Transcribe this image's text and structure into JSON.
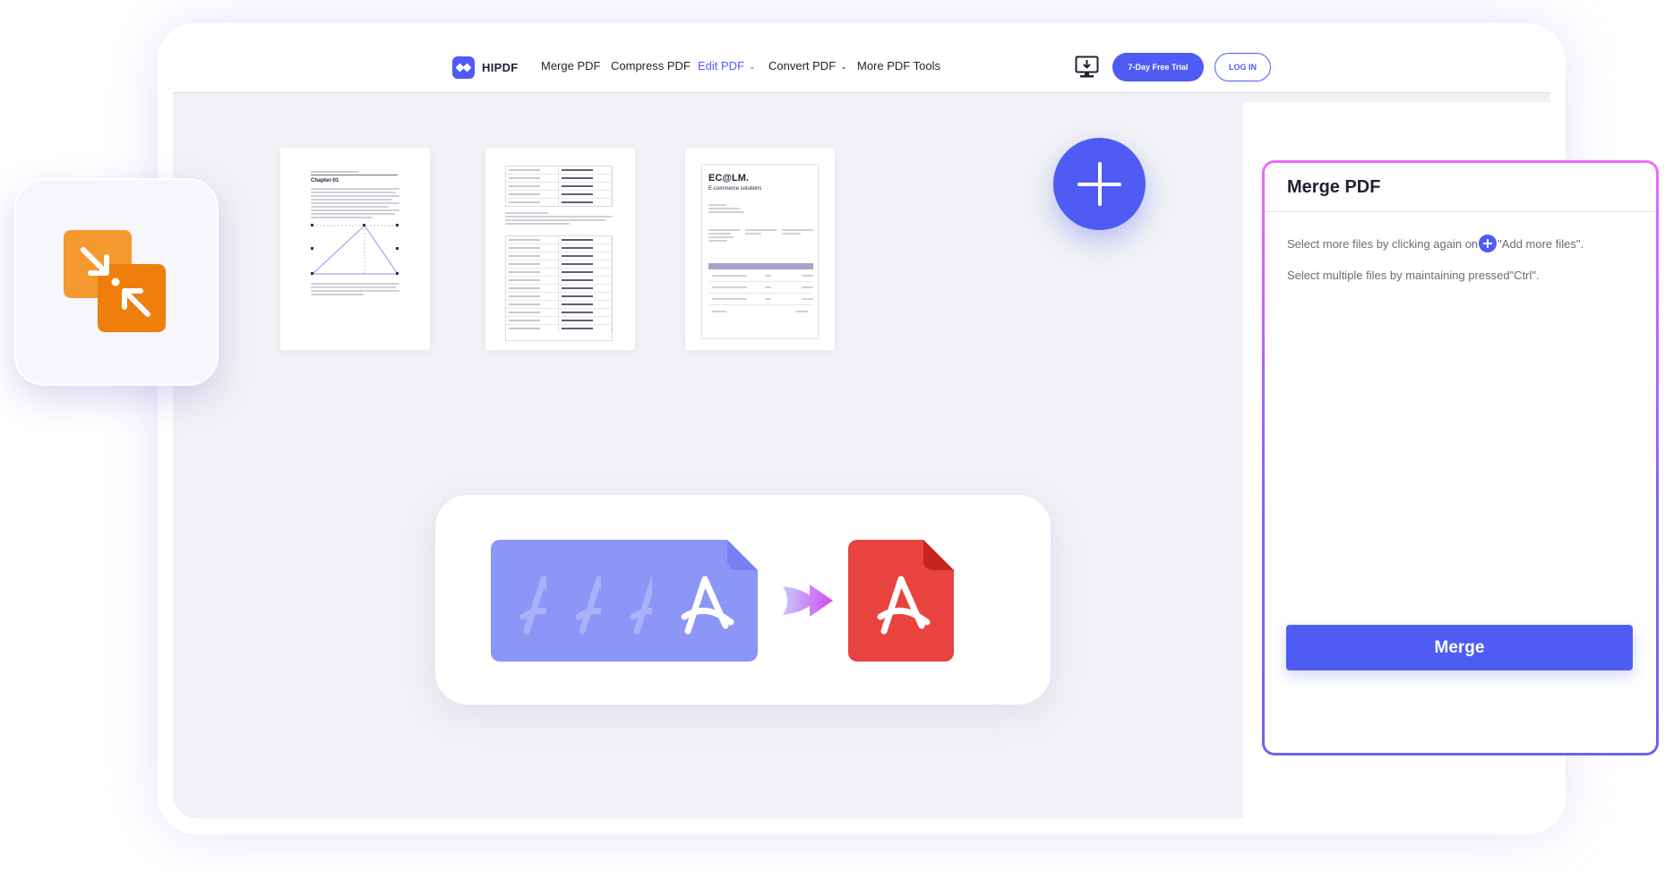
{
  "nav": {
    "logo_text": "HIPDF",
    "items": [
      {
        "label": "Merge PDF",
        "active": false
      },
      {
        "label": "Compress PDF",
        "active": false
      },
      {
        "label": "Edit PDF",
        "active": true,
        "dropdown": true
      },
      {
        "label": "Convert PDF",
        "active": false,
        "dropdown": true
      },
      {
        "label": "More PDF Tools",
        "active": false
      }
    ],
    "trial_button": "7-Day Free Trial",
    "login_button": "LOG IN",
    "desktop_icon": "monitor-download-icon"
  },
  "documents": [
    {
      "kind": "article",
      "heading": "Chapter-01"
    },
    {
      "kind": "table"
    },
    {
      "kind": "invoice",
      "brand": "EC@LM.",
      "tagline": "E-commerce solutions"
    }
  ],
  "add_button_icon": "plus-icon",
  "panel": {
    "title": "Merge PDF",
    "hint_1_before": "Select more files by clicking again on",
    "hint_1_after": "\"Add more files\".",
    "hint_2": "Select multiple files by maintaining pressed\"Ctrl\".",
    "merge_button": "Merge"
  },
  "colors": {
    "accent": "#4e5cf4",
    "pdf_blue": "#8b96f6",
    "pdf_red": "#e8433f",
    "compress_orange": "#f28a1e",
    "panel_border_top": "#ef6cff",
    "panel_border_bottom": "#6c63f0"
  },
  "icons": [
    "compress-icon",
    "pdf-file-icon",
    "merge-arrow-icon",
    "acrobat-icon"
  ]
}
